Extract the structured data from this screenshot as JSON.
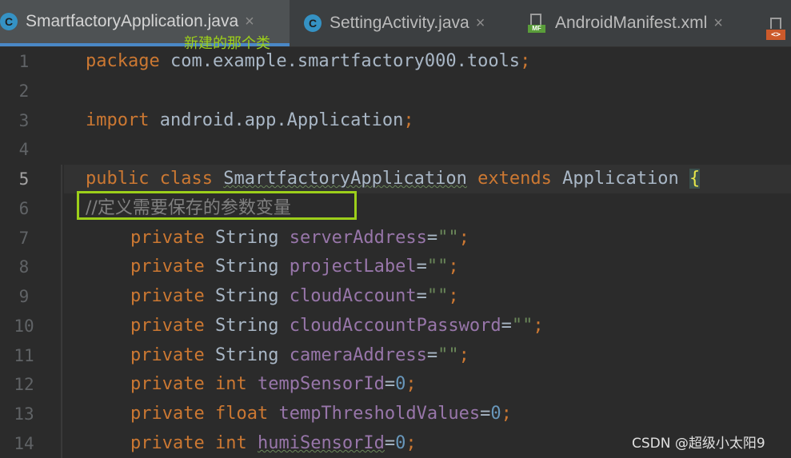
{
  "tabs": [
    {
      "label": "SmartfactoryApplication.java",
      "icon": "java-class-icon",
      "active": true
    },
    {
      "label": "SettingActivity.java",
      "icon": "java-class-icon",
      "active": false
    },
    {
      "label": "AndroidManifest.xml",
      "icon": "manifest-icon",
      "active": false
    }
  ],
  "tab_close_glyph": "×",
  "icons": {
    "java_letter": "C",
    "manifest_label": "MF",
    "xml_label": "<>"
  },
  "annotation": "新建的那个类",
  "line_numbers": [
    "1",
    "2",
    "3",
    "4",
    "5",
    "6",
    "7",
    "8",
    "9",
    "10",
    "11",
    "12",
    "13",
    "14"
  ],
  "code": {
    "l1": {
      "kw": "package",
      "rest": " com.example.smartfactory000.tools",
      "semi": ";"
    },
    "l3": {
      "kw": "import",
      "rest": " android.app.Application",
      "semi": ";"
    },
    "l5": {
      "kw1": "public",
      "kw2": "class",
      "name": "SmartfactoryApplication",
      "kw3": "extends",
      "parent": "Application",
      "brace": "{"
    },
    "l6": {
      "slash": "//",
      "comment": "定义需要保存的参数变量"
    },
    "fields": [
      {
        "mod": "private",
        "type": "String",
        "name": "serverAddress",
        "eq": "=",
        "val": "\"\"",
        "semi": ";"
      },
      {
        "mod": "private",
        "type": "String",
        "name": "projectLabel",
        "eq": "=",
        "val": "\"\"",
        "semi": ";"
      },
      {
        "mod": "private",
        "type": "String",
        "name": "cloudAccount",
        "eq": "=",
        "val": "\"\"",
        "semi": ";"
      },
      {
        "mod": "private",
        "type": "String",
        "name": "cloudAccountPassword",
        "eq": "=",
        "val": "\"\"",
        "semi": ";"
      },
      {
        "mod": "private",
        "type": "String",
        "name": "cameraAddress",
        "eq": "=",
        "val": "\"\"",
        "semi": ";"
      },
      {
        "mod": "private",
        "type": "int",
        "name": "tempSensorId",
        "eq": "=",
        "val": "0",
        "semi": ";"
      },
      {
        "mod": "private",
        "type": "float",
        "name": "tempThresholdValues",
        "eq": "=",
        "val": "0",
        "semi": ";"
      },
      {
        "mod": "private",
        "type": "int",
        "name": "humiSensorId",
        "eq": "=",
        "val": "0",
        "semi": ";"
      }
    ]
  },
  "watermark": "CSDN @超级小太阳9",
  "colors": {
    "keyword": "#cc7832",
    "field": "#9876aa",
    "number": "#6897bb",
    "string": "#6a8759",
    "comment": "#808080",
    "annotation": "#9ccf1a",
    "tab_accent": "#4a88c7"
  }
}
